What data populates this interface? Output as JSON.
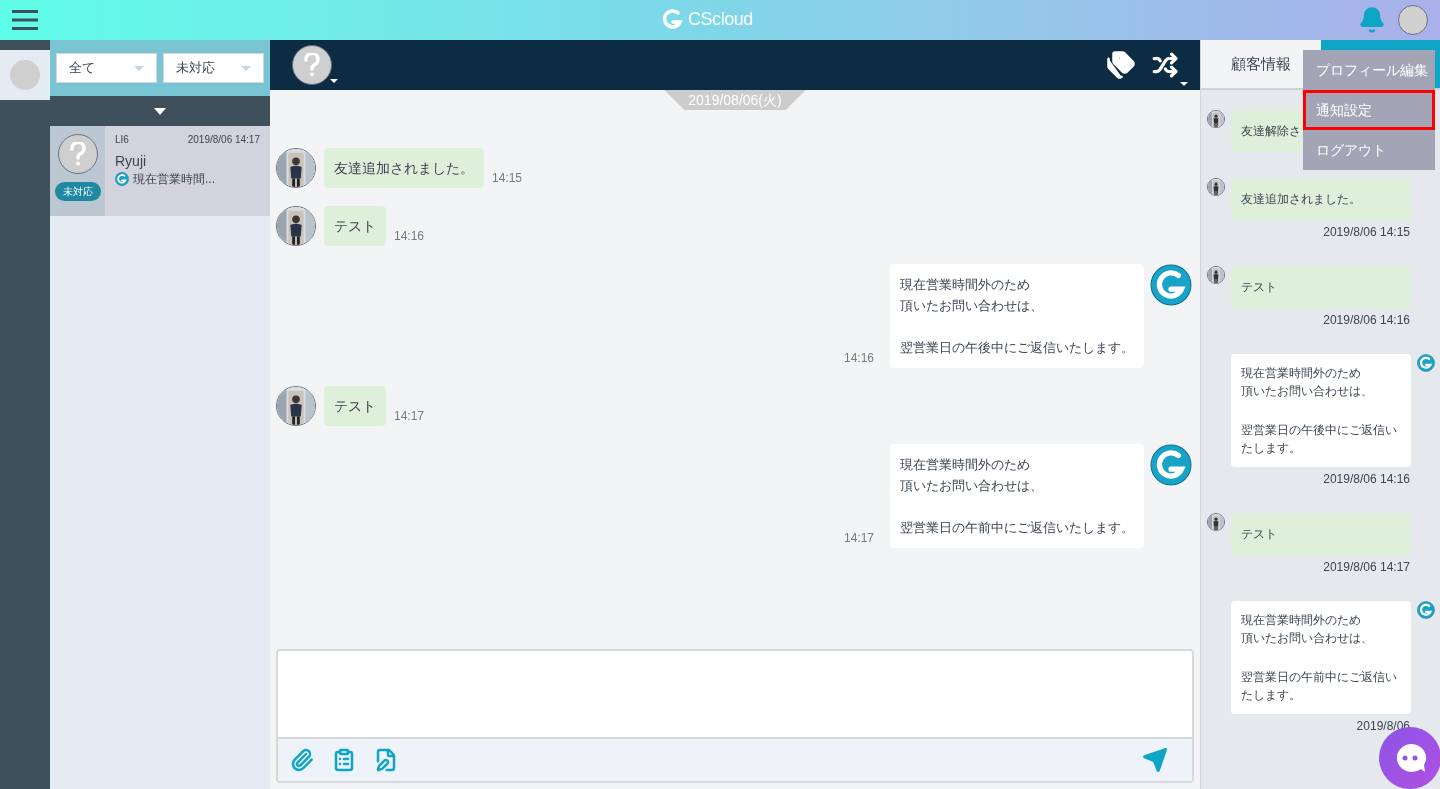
{
  "header": {
    "logo": "CScloud"
  },
  "filters": [
    {
      "value": "全て"
    },
    {
      "value": "未対応"
    }
  ],
  "conversations": [
    {
      "channel": "LI6",
      "time": "2019/8/06 14:17",
      "name": "Ryuji",
      "preview": "現在営業時間...",
      "status": "未対応",
      "selected": true
    }
  ],
  "chat": {
    "date": "2019/08/06(火)",
    "messages": [
      {
        "kind": "customer",
        "text": "友達追加されました。",
        "time": "14:15"
      },
      {
        "kind": "customer",
        "text": "テスト",
        "time": "14:16"
      },
      {
        "kind": "agent",
        "paragraphs": [
          [
            "現在営業時間外のため",
            "頂いたお問い合わせは、"
          ],
          [
            "翌営業日の午後中にご返信いたします。"
          ]
        ],
        "time": "14:16"
      },
      {
        "kind": "customer",
        "text": "テスト",
        "time": "14:17"
      },
      {
        "kind": "agent",
        "paragraphs": [
          [
            "現在営業時間外のため",
            "頂いたお問い合わせは、"
          ],
          [
            "翌営業日の午前中にご返信いたします。"
          ]
        ],
        "time": "14:17"
      }
    ]
  },
  "right_panel": {
    "tabs": [
      {
        "label": "顧客情報",
        "selected": false
      },
      {
        "selected": true
      }
    ],
    "history": [
      {
        "kind": "customer",
        "text": "友達解除さ"
      },
      {
        "kind": "customer",
        "text": "友達追加されました。",
        "time": "2019/8/06 14:15"
      },
      {
        "kind": "customer",
        "text": "テスト",
        "time": "2019/8/06 14:16"
      },
      {
        "kind": "agent",
        "paragraphs": [
          [
            "現在営業時間外のため",
            "頂いたお問い合わせは、"
          ],
          [
            "翌営業日の午後中にご返信いたします。"
          ]
        ],
        "time": "2019/8/06 14:16"
      },
      {
        "kind": "customer",
        "text": "テスト",
        "time": "2019/8/06 14:17"
      },
      {
        "kind": "agent",
        "paragraphs": [
          [
            "現在営業時間外のため",
            "頂いたお問い合わせは、"
          ],
          [
            "翌営業日の午前中にご返信いたします。"
          ]
        ],
        "time": "2019/8/06"
      }
    ]
  },
  "user_menu": [
    {
      "label": "プロフィール編集",
      "highlighted": false
    },
    {
      "label": "通知設定",
      "highlighted": true
    },
    {
      "label": "ログアウト",
      "highlighted": false
    }
  ]
}
